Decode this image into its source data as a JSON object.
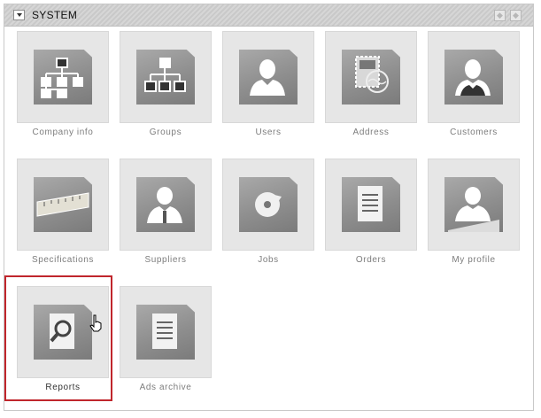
{
  "panel": {
    "title": "SYSTEM"
  },
  "tiles": [
    {
      "label": "Company info",
      "icon": "org-chart-icon"
    },
    {
      "label": "Groups",
      "icon": "groups-hierarchy-icon"
    },
    {
      "label": "Users",
      "icon": "user-icon"
    },
    {
      "label": "Address",
      "icon": "stamp-address-icon"
    },
    {
      "label": "Customers",
      "icon": "customer-icon"
    },
    {
      "label": "Specifications",
      "icon": "ruler-icon"
    },
    {
      "label": "Suppliers",
      "icon": "supplier-icon"
    },
    {
      "label": "Jobs",
      "icon": "refresh-icon"
    },
    {
      "label": "Orders",
      "icon": "document-icon"
    },
    {
      "label": "My profile",
      "icon": "profile-icon"
    },
    {
      "label": "Reports",
      "icon": "report-search-icon",
      "selected": true
    },
    {
      "label": "Ads archive",
      "icon": "archive-document-icon"
    }
  ],
  "colors": {
    "selection": "#c0262c",
    "tile_bg": "#e6e6e6",
    "label": "#7d7d7d"
  }
}
